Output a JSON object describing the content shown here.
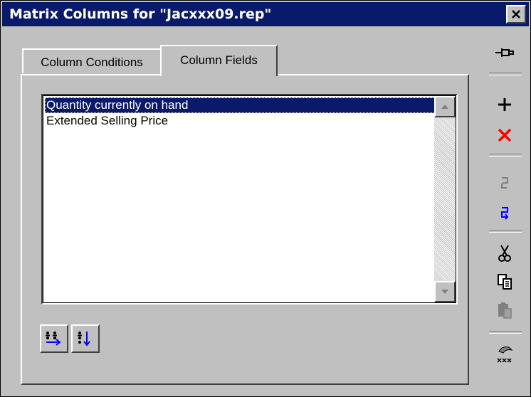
{
  "window": {
    "title": "Matrix Columns for \"Jacxxx09.rep\""
  },
  "tabs": [
    {
      "label": "Column Conditions",
      "active": false
    },
    {
      "label": "Column Fields",
      "active": true
    }
  ],
  "list": {
    "items": [
      {
        "label": "Quantity currently on hand",
        "selected": true
      },
      {
        "label": "Extended Selling Price",
        "selected": false
      }
    ]
  },
  "toolbar": {
    "icons": [
      "pin-icon",
      "add-icon",
      "delete-icon",
      "undo-icon",
      "redo-icon",
      "cut-icon",
      "copy-icon",
      "paste-icon",
      "rename-icon"
    ]
  },
  "bottom_buttons": [
    "move-right-icon",
    "move-down-icon"
  ],
  "colors": {
    "titlebar": "#0a1a6b",
    "face": "#c0c0c0",
    "selection": "#0a1a6b",
    "delete": "#ff0000",
    "redo": "#0000ff"
  }
}
